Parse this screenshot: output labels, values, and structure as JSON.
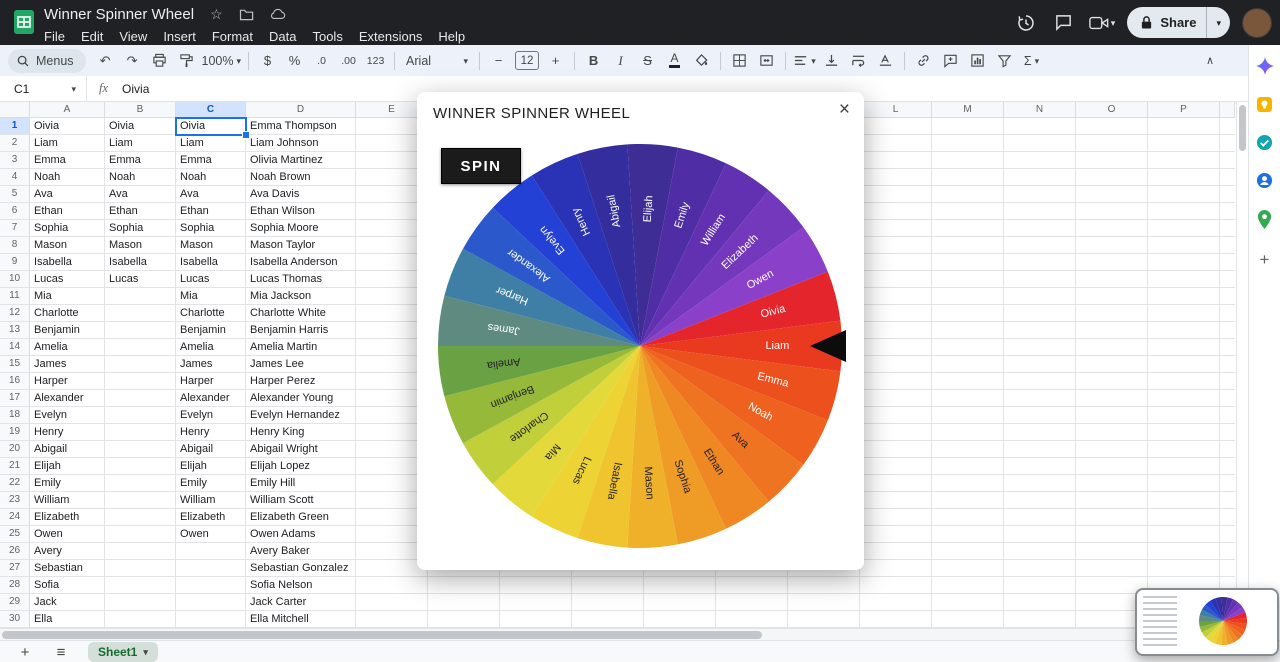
{
  "titlebar": {
    "title": "Winner Spinner Wheel",
    "menus": [
      "File",
      "Edit",
      "View",
      "Insert",
      "Format",
      "Data",
      "Tools",
      "Extensions",
      "Help"
    ],
    "share_label": "Share"
  },
  "icons": {
    "caret": "▾",
    "star": "☆",
    "close": "×",
    "plus": "+",
    "hamburger": "≡",
    "undo": "↶",
    "redo": "↷",
    "minus": "−",
    "collapse": "∧",
    "sigma": "Σ"
  },
  "toolbar": {
    "menus_label": "Menus",
    "zoom": "100%",
    "currency": "$",
    "percent": "%",
    "dec_dec": ".0",
    "dec_inc": ".00",
    "number_format": "123",
    "font": "Arial",
    "font_size": "12",
    "bold": "B",
    "italic": "I",
    "strike": "S",
    "text_color": "A"
  },
  "formula_bar": {
    "cell_ref": "C1",
    "fx": "fx",
    "value": "Oivia"
  },
  "grid": {
    "left_columns": [
      "A",
      "B",
      "C",
      "D",
      "E"
    ],
    "right_columns": [
      "L",
      "M",
      "N",
      "O",
      "P"
    ],
    "selected": {
      "ref": "C1",
      "column": "C",
      "row": 1
    },
    "rows": [
      {
        "n": 1,
        "a": "Oivia",
        "b": "Oivia",
        "c": "Oivia",
        "d": "Emma Thompson"
      },
      {
        "n": 2,
        "a": "Liam",
        "b": "Liam",
        "c": "Liam",
        "d": "Liam Johnson"
      },
      {
        "n": 3,
        "a": "Emma",
        "b": "Emma",
        "c": "Emma",
        "d": "Olivia Martinez"
      },
      {
        "n": 4,
        "a": "Noah",
        "b": "Noah",
        "c": "Noah",
        "d": "Noah Brown"
      },
      {
        "n": 5,
        "a": "Ava",
        "b": "Ava",
        "c": "Ava",
        "d": "Ava Davis"
      },
      {
        "n": 6,
        "a": "Ethan",
        "b": "Ethan",
        "c": "Ethan",
        "d": "Ethan Wilson"
      },
      {
        "n": 7,
        "a": "Sophia",
        "b": "Sophia",
        "c": "Sophia",
        "d": "Sophia Moore"
      },
      {
        "n": 8,
        "a": "Mason",
        "b": "Mason",
        "c": "Mason",
        "d": "Mason Taylor"
      },
      {
        "n": 9,
        "a": "Isabella",
        "b": "Isabella",
        "c": "Isabella",
        "d": "Isabella Anderson"
      },
      {
        "n": 10,
        "a": "Lucas",
        "b": "Lucas",
        "c": "Lucas",
        "d": "Lucas Thomas"
      },
      {
        "n": 11,
        "a": "Mia",
        "b": "",
        "c": "Mia",
        "d": "Mia Jackson"
      },
      {
        "n": 12,
        "a": "Charlotte",
        "b": "",
        "c": "Charlotte",
        "d": "Charlotte White"
      },
      {
        "n": 13,
        "a": "Benjamin",
        "b": "",
        "c": "Benjamin",
        "d": "Benjamin Harris"
      },
      {
        "n": 14,
        "a": "Amelia",
        "b": "",
        "c": "Amelia",
        "d": "Amelia Martin"
      },
      {
        "n": 15,
        "a": "James",
        "b": "",
        "c": "James",
        "d": "James Lee"
      },
      {
        "n": 16,
        "a": "Harper",
        "b": "",
        "c": "Harper",
        "d": "Harper Perez"
      },
      {
        "n": 17,
        "a": "Alexander",
        "b": "",
        "c": "Alexander",
        "d": "Alexander Young"
      },
      {
        "n": 18,
        "a": "Evelyn",
        "b": "",
        "c": "Evelyn",
        "d": "Evelyn Hernandez"
      },
      {
        "n": 19,
        "a": "Henry",
        "b": "",
        "c": "Henry",
        "d": "Henry King"
      },
      {
        "n": 20,
        "a": "Abigail",
        "b": "",
        "c": "Abigail",
        "d": "Abigail Wright"
      },
      {
        "n": 21,
        "a": "Elijah",
        "b": "",
        "c": "Elijah",
        "d": "Elijah Lopez"
      },
      {
        "n": 22,
        "a": "Emily",
        "b": "",
        "c": "Emily",
        "d": "Emily Hill"
      },
      {
        "n": 23,
        "a": "William",
        "b": "",
        "c": "William",
        "d": "William Scott"
      },
      {
        "n": 24,
        "a": "Elizabeth",
        "b": "",
        "c": "Elizabeth",
        "d": "Elizabeth Green"
      },
      {
        "n": 25,
        "a": "Owen",
        "b": "",
        "c": "Owen",
        "d": "Owen Adams"
      },
      {
        "n": 26,
        "a": "Avery",
        "b": "",
        "c": "",
        "d": "Avery Baker"
      },
      {
        "n": 27,
        "a": "Sebastian",
        "b": "",
        "c": "",
        "d": "Sebastian Gonzalez"
      },
      {
        "n": 28,
        "a": "Sofia",
        "b": "",
        "c": "",
        "d": "Sofia Nelson"
      },
      {
        "n": 29,
        "a": "Jack",
        "b": "",
        "c": "",
        "d": "Jack Carter"
      },
      {
        "n": 30,
        "a": "Ella",
        "b": "",
        "c": "",
        "d": "Ella Mitchell"
      }
    ]
  },
  "modal": {
    "title": "WINNER SPINNER WHEEL",
    "spin": "SPIN"
  },
  "chart_data": {
    "type": "pie",
    "title": "WINNER SPINNER WHEEL",
    "legend": "none",
    "pointer_at": "Liam",
    "start_angle_deg": -3.6,
    "segment_sweep_deg": 14.4,
    "segments": [
      {
        "label": "Elijah",
        "value": 1,
        "color": "#3f2d96",
        "text": "#ffffff"
      },
      {
        "label": "Emily",
        "value": 1,
        "color": "#4f2da5",
        "text": "#ffffff"
      },
      {
        "label": "William",
        "value": 1,
        "color": "#6131b2",
        "text": "#ffffff"
      },
      {
        "label": "Elizabeth",
        "value": 1,
        "color": "#7438bd",
        "text": "#ffffff"
      },
      {
        "label": "Owen",
        "value": 1,
        "color": "#8a40c8",
        "text": "#ffffff"
      },
      {
        "label": "Oivia",
        "value": 1,
        "color": "#e4252b",
        "text": "#ffffff"
      },
      {
        "label": "Liam",
        "value": 1,
        "color": "#e93a20",
        "text": "#ffffff"
      },
      {
        "label": "Emma",
        "value": 1,
        "color": "#ec501d",
        "text": "#ffffff"
      },
      {
        "label": "Noah",
        "value": 1,
        "color": "#ee611f",
        "text": "#ffffff"
      },
      {
        "label": "Ava",
        "value": 1,
        "color": "#ef7421",
        "text": "#222222"
      },
      {
        "label": "Ethan",
        "value": 1,
        "color": "#ef8723",
        "text": "#222222"
      },
      {
        "label": "Sophia",
        "value": 1,
        "color": "#ef9c26",
        "text": "#222222"
      },
      {
        "label": "Mason",
        "value": 1,
        "color": "#efb02a",
        "text": "#222222"
      },
      {
        "label": "Isabella",
        "value": 1,
        "color": "#efc42e",
        "text": "#222222"
      },
      {
        "label": "Lucas",
        "value": 1,
        "color": "#edd334",
        "text": "#222222"
      },
      {
        "label": "Mia",
        "value": 1,
        "color": "#e4d93a",
        "text": "#222222"
      },
      {
        "label": "Charlotte",
        "value": 1,
        "color": "#c1cf3a",
        "text": "#222222"
      },
      {
        "label": "Benjamin",
        "value": 1,
        "color": "#97b93a",
        "text": "#222222"
      },
      {
        "label": "Amelia",
        "value": 1,
        "color": "#69a143",
        "text": "#222222"
      },
      {
        "label": "James",
        "value": 1,
        "color": "#5e8a80",
        "text": "#ffffff"
      },
      {
        "label": "Harper",
        "value": 1,
        "color": "#3f7fa6",
        "text": "#ffffff"
      },
      {
        "label": "Alexander",
        "value": 1,
        "color": "#2b59cc",
        "text": "#ffffff"
      },
      {
        "label": "Evelyn",
        "value": 1,
        "color": "#2441d6",
        "text": "#ffffff"
      },
      {
        "label": "Henry",
        "value": 1,
        "color": "#2a32b5",
        "text": "#ffffff"
      },
      {
        "label": "Abigail",
        "value": 1,
        "color": "#332d9e",
        "text": "#ffffff"
      }
    ]
  },
  "sheet_tabs": {
    "active": "Sheet1"
  }
}
